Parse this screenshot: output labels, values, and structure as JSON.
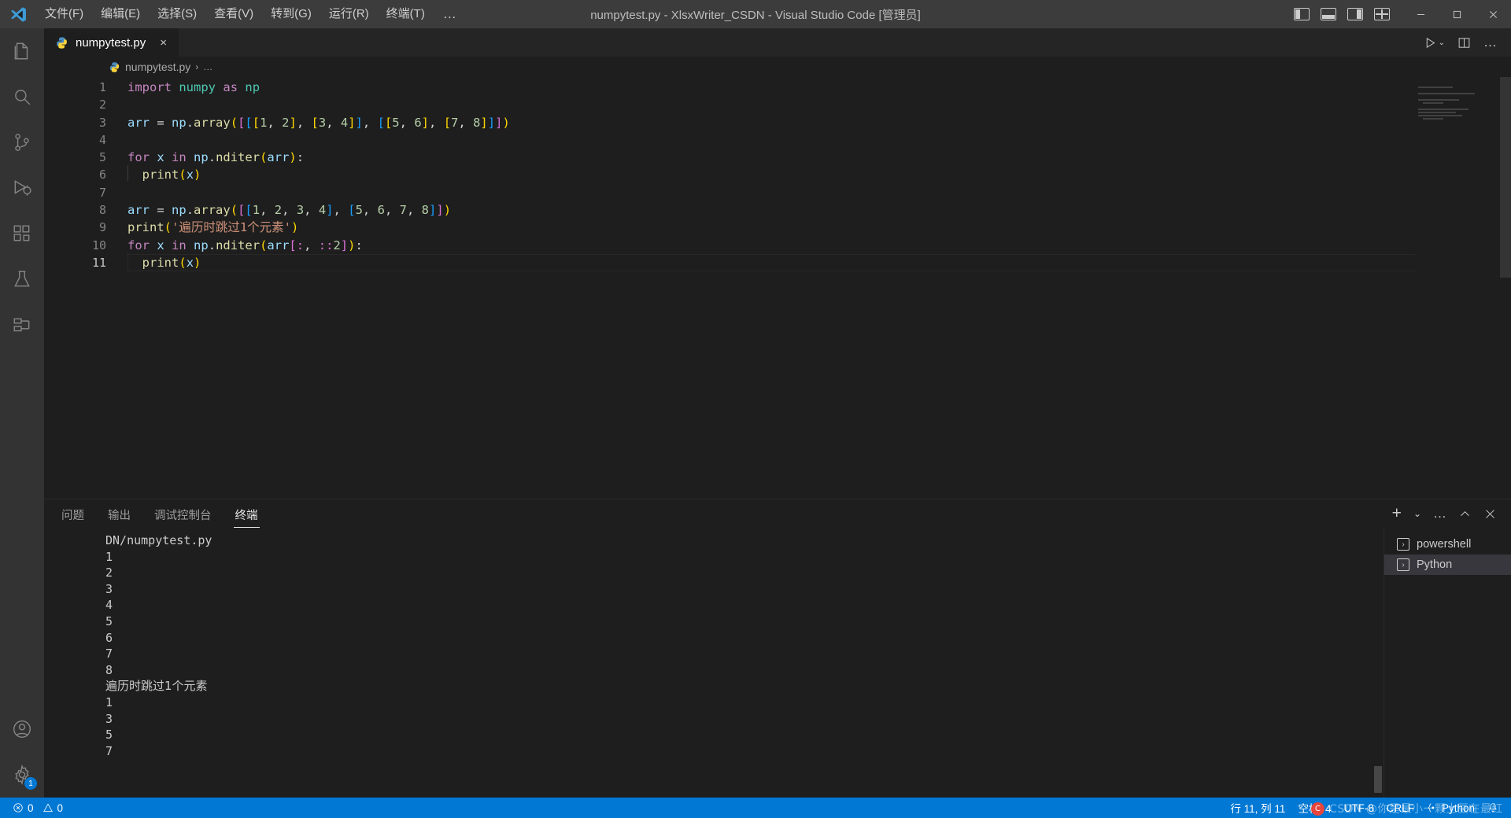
{
  "window": {
    "title": "numpytest.py - XlsxWriter_CSDN - Visual Studio Code [管理员]",
    "logo": "vscode-logo",
    "minimize": "minimize-icon",
    "maximize": "maximize-icon",
    "close": "close-icon"
  },
  "menu": {
    "items": [
      {
        "label": "文件(F)"
      },
      {
        "label": "编辑(E)"
      },
      {
        "label": "选择(S)"
      },
      {
        "label": "查看(V)"
      },
      {
        "label": "转到(G)"
      },
      {
        "label": "运行(R)"
      },
      {
        "label": "终端(T)"
      }
    ],
    "more": "…"
  },
  "activitybar": {
    "items": [
      {
        "name": "explorer",
        "icon": "files-icon"
      },
      {
        "name": "search",
        "icon": "search-icon"
      },
      {
        "name": "source-control",
        "icon": "source-control-icon"
      },
      {
        "name": "run-and-debug",
        "icon": "run-debug-icon"
      },
      {
        "name": "extensions",
        "icon": "extensions-icon"
      },
      {
        "name": "testing",
        "icon": "beaker-icon"
      },
      {
        "name": "remote-explorer",
        "icon": "remote-icon"
      }
    ],
    "bottom": [
      {
        "name": "accounts",
        "icon": "account-icon"
      },
      {
        "name": "manage",
        "icon": "gear-icon",
        "badge": "1"
      }
    ]
  },
  "editor": {
    "tab": {
      "label": "numpytest.py",
      "icon": "python-file-icon",
      "close": "×"
    },
    "actions": {
      "run": "run-icon",
      "run_dropdown": "chevron-down-icon",
      "split": "split-editor-icon",
      "more": "…"
    },
    "breadcrumb": {
      "file": "numpytest.py",
      "separator": "›",
      "more": "…"
    },
    "lines": [
      {
        "n": "1",
        "text": "import numpy as np"
      },
      {
        "n": "2",
        "text": ""
      },
      {
        "n": "3",
        "text": "arr = np.array([[[1, 2], [3, 4]], [[5, 6], [7, 8]]])"
      },
      {
        "n": "4",
        "text": ""
      },
      {
        "n": "5",
        "text": "for x in np.nditer(arr):"
      },
      {
        "n": "6",
        "text": "  print(x)"
      },
      {
        "n": "7",
        "text": ""
      },
      {
        "n": "8",
        "text": "arr = np.array([[1, 2, 3, 4], [5, 6, 7, 8]])"
      },
      {
        "n": "9",
        "text": "print('遍历时跳过1个元素')"
      },
      {
        "n": "10",
        "text": "for x in np.nditer(arr[:, ::2]):"
      },
      {
        "n": "11",
        "text": "  print(x)"
      }
    ]
  },
  "panel": {
    "tabs": [
      {
        "label": "问题",
        "active": false
      },
      {
        "label": "输出",
        "active": false
      },
      {
        "label": "调试控制台",
        "active": false
      },
      {
        "label": "终端",
        "active": true
      }
    ],
    "actions": {
      "new_terminal": "+",
      "new_dropdown": "chevron-down-icon",
      "views_more": "…",
      "maximize": "chevron-up-icon",
      "close": "close-icon"
    },
    "terminal_output": [
      "DN/numpytest.py",
      "1",
      "2",
      "3",
      "4",
      "5",
      "6",
      "7",
      "8",
      "遍历时跳过1个元素",
      "1",
      "3",
      "5",
      "7"
    ],
    "terminal_list": [
      {
        "label": "powershell",
        "icon": "terminal-chevron-icon",
        "selected": false
      },
      {
        "label": "Python",
        "icon": "terminal-chevron-icon",
        "selected": true
      }
    ]
  },
  "statusbar": {
    "errors": "0",
    "warnings": "0",
    "error_icon": "error-circle-icon",
    "warning_icon": "warning-triangle-icon",
    "position": "行 11, 列 11",
    "indent": "空格: 4",
    "encoding": "UTF-8",
    "eol": "CRLF",
    "language": "Python",
    "language_icon": "python-brackets-icon",
    "notification_icon": "bell-icon"
  },
  "watermark": {
    "text": "CSDN @你是最小一颗土豆在最红",
    "badge": "C"
  },
  "colors": {
    "titlebar": "#3c3c3c",
    "activitybar": "#333333",
    "editor": "#1e1e1e",
    "statusbar": "#0078d4",
    "accent": "#0078d4"
  }
}
